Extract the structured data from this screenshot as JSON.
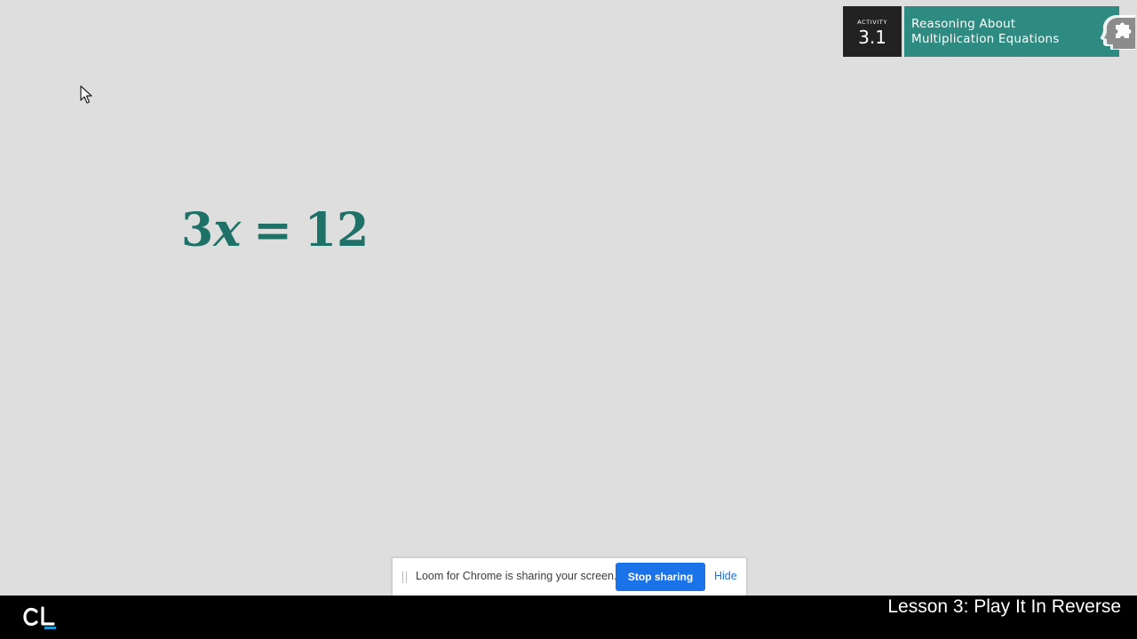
{
  "activity": {
    "label": "ACTIVITY",
    "number": "3.1",
    "title_line1": "Reasoning About",
    "title_line2": "Multiplication Equations"
  },
  "equation": {
    "coefficient": "3",
    "variable": "x",
    "operator": "=",
    "result": "12"
  },
  "share_bar": {
    "message": "Loom for Chrome is sharing your screen.",
    "stop_label": "Stop sharing",
    "hide_label": "Hide"
  },
  "footer": {
    "lesson_title": "Lesson 3: Play It In Reverse"
  },
  "colors": {
    "background": "#dedede",
    "equation": "#1d7167",
    "activity_teal": "#2e8b82",
    "activity_dark": "#222222",
    "stop_button": "#1a73e8",
    "footer": "#000000"
  },
  "icons": [
    "head-puzzle-icon",
    "mouse-cursor-icon",
    "cl-logo-icon",
    "drag-handle-icon"
  ]
}
